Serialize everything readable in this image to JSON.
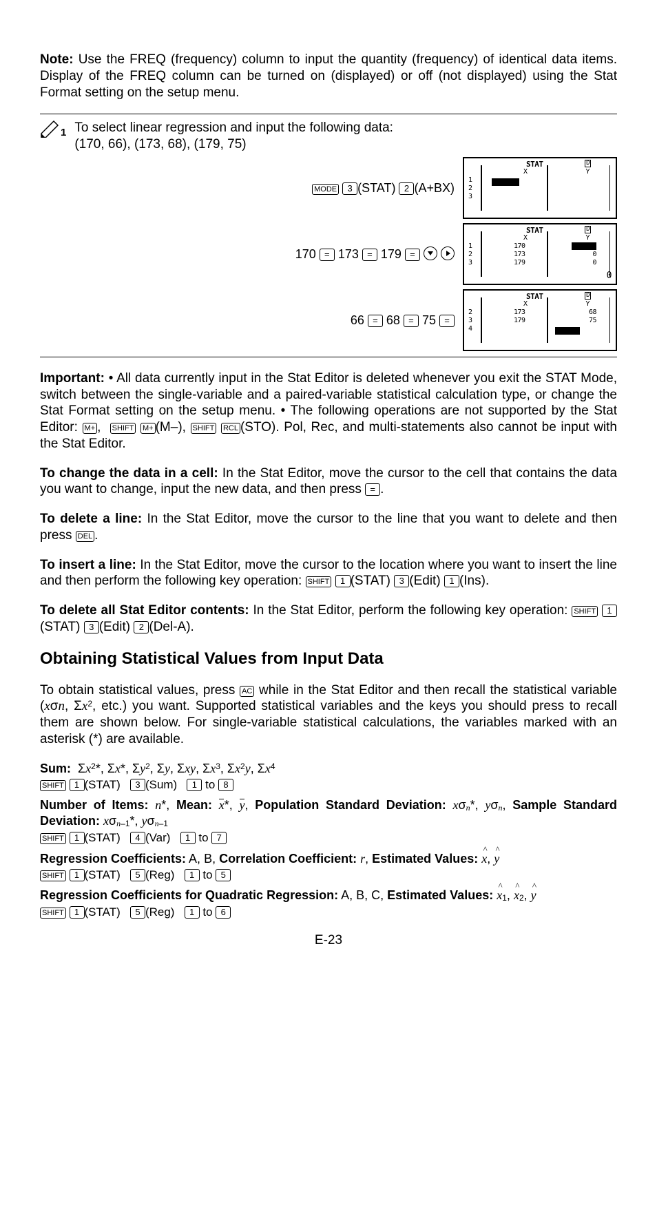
{
  "note": {
    "label": "Note:",
    "text": "  Use the FREQ (frequency) column to input the quantity (frequency) of identical data items. Display of the FREQ column can be turned on (displayed) or off (not displayed) using the Stat Format setting on the setup menu."
  },
  "example": {
    "idx": "1",
    "intro": "To select linear regression and input the following data:",
    "data_pairs": "(170, 66), (173, 68), (179, 75)",
    "step1_label": "(STAT)",
    "step1_label2": "(A+BX)",
    "step2_vals": [
      "170",
      "173",
      "179"
    ],
    "step3_vals": [
      "66",
      "68",
      "75"
    ],
    "lcd": {
      "stat": "STAT",
      "d": "D",
      "x": "X",
      "y": "Y",
      "rows1": "1\n2\n3",
      "rows2": "1\n2\n3",
      "rows3": "2\n3\n4",
      "xvals2": "170\n173\n179",
      "xvals3": "173\n179",
      "yvals2": "\n0\n0",
      "yvals3": "68\n75",
      "zero": "0"
    }
  },
  "important": {
    "label": "Important:",
    "p1a": "  • All data currently input in the Stat Editor is deleted whenever you exit the STAT Mode, switch between the single-variable and a paired-variable statistical calculation type, or change the Stat Format setting on the setup menu.  • The following operations are not supported by the Stat Editor: ",
    "p1b": "(M–), ",
    "p1c": "(STO). Pol, Rec, and multi-statements also cannot be input with the Stat Editor."
  },
  "change_cell": {
    "label": "To change the data in a cell:",
    "text": " In the Stat Editor, move the cursor to the cell that contains the data you want to change, input the new data, and then press "
  },
  "delete_line": {
    "label": "To delete a line:",
    "text": " In the Stat Editor, move the cursor to the line that you want to delete and then press "
  },
  "insert_line": {
    "label": "To insert a line:",
    "text": " In the Stat Editor, move the cursor to the location where you want to insert the line and then perform the following key operation: ",
    "seq": [
      "(STAT)",
      "(Edit)",
      "(Ins)."
    ]
  },
  "delete_all": {
    "label": "To delete all Stat Editor contents:",
    "text": " In the Stat Editor, perform the following key operation: ",
    "seq": [
      "(STAT)",
      "(Edit)",
      "(Del-A)."
    ]
  },
  "obtain": {
    "heading": "Obtaining Statistical Values from Input Data",
    "p": "To obtain statistical values, press ",
    "p2": " while in the Stat Editor and then recall the statistical variable (",
    "p2b": ", etc.) you want. Supported statistical variables and the keys you should press to recall them are shown below. For single-variable statistical calculations, the variables marked with an asterisk (*) are available."
  },
  "sum": {
    "label": "Sum:",
    "menu": [
      "(STAT)",
      "(Sum)",
      "to"
    ]
  },
  "numitems": {
    "label_items": "Number of Items:",
    "label_mean": "Mean:",
    "label_pop": "Population Standard Deviation:",
    "label_samp": "Sample Standard Deviation:",
    "menu": [
      "(STAT)",
      "(Var)",
      "to"
    ]
  },
  "reg": {
    "label_coef": "Regression Coefficients:",
    "coefs": " A, B, ",
    "label_corr": "Correlation Coefficient:",
    "label_est": "Estimated Values:",
    "menu": [
      "(STAT)",
      "(Reg)",
      "to"
    ]
  },
  "regquad": {
    "label": "Regression Coefficients for Quadratic Regression:",
    "coefs": " A, B, C, ",
    "label_est": "Estimated Values:",
    "menu": [
      "(STAT)",
      "(Reg)",
      "to"
    ]
  },
  "keys": {
    "mode": "MODE",
    "shift": "SHIFT",
    "del": "DEL",
    "ac": "AC",
    "eq": "=",
    "mplus": "M+",
    "rcl": "RCL",
    "n1": "1",
    "n2": "2",
    "n3": "3",
    "n4": "4",
    "n5": "5",
    "n6": "6",
    "n7": "7",
    "n8": "8"
  },
  "chart_data": {
    "type": "table",
    "title": "Linear regression input data",
    "columns": [
      "X",
      "Y"
    ],
    "rows": [
      [
        170,
        66
      ],
      [
        173,
        68
      ],
      [
        179,
        75
      ]
    ]
  },
  "page": "E-23"
}
